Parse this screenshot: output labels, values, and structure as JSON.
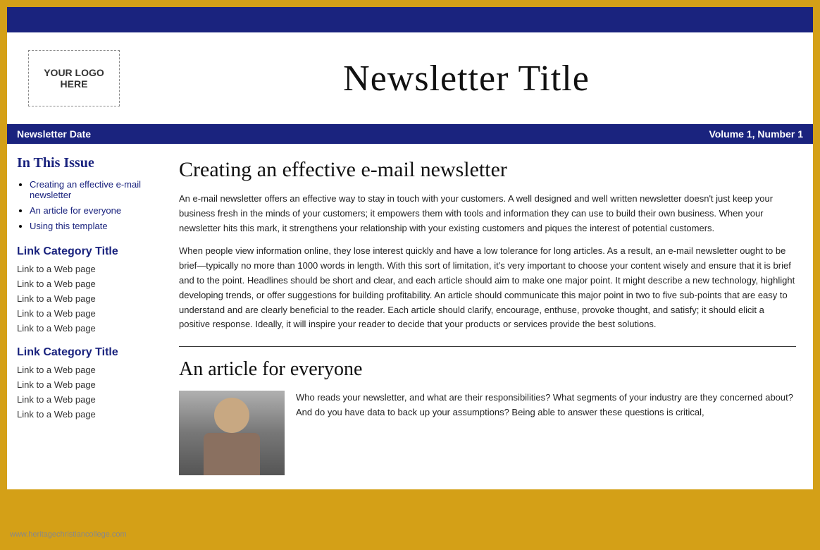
{
  "header": {
    "logo_line1": "YOUR LOGO",
    "logo_line2": "HERE",
    "newsletter_title": "Newsletter Title"
  },
  "date_bar": {
    "newsletter_date": "Newsletter Date",
    "volume": "Volume 1, Number 1"
  },
  "sidebar": {
    "in_this_issue_title": "In This Issue",
    "toc_items": [
      "Creating an effective e-mail newsletter",
      "An article for everyone",
      "Using this template"
    ],
    "link_category_1": {
      "title": "Link Category Title",
      "links": [
        "Link to a Web page",
        "Link to a Web page",
        "Link to a Web page",
        "Link to a Web page",
        "Link to a Web page"
      ]
    },
    "link_category_2": {
      "title": "Link Category Title",
      "links": [
        "Link to a Web page",
        "Link to a Web page",
        "Link to a Web page",
        "Link to a Web page"
      ]
    }
  },
  "main": {
    "article1": {
      "title": "Creating an effective e-mail newsletter",
      "paragraphs": [
        "An e-mail newsletter offers an effective way to stay in touch with your customers. A well designed and well written newsletter doesn't just keep your business fresh in the minds of your customers; it empowers them with tools and information they can use to build their own business. When your newsletter hits this mark, it strengthens your relationship with your existing customers and piques the interest of potential customers.",
        "When people view information online, they lose interest quickly and have a low tolerance for long articles. As a result, an e-mail newsletter ought to be brief—typically no more than 1000 words in length. With this sort of limitation, it's very important to choose your content wisely and ensure that it is brief and to the point. Headlines should be short and clear, and each article should aim to make one major point. It might describe a new technology, highlight developing trends, or offer suggestions for building profitability. An article should communicate this major point in two to five sub-points that are easy to understand and are clearly beneficial to the reader. Each article should clarify, encourage, enthuse, provoke thought, and satisfy; it should elicit a positive response. Ideally, it will inspire your reader to decide that your products or services provide the best solutions."
      ]
    },
    "article2": {
      "title": "An article for everyone",
      "body": "Who reads your newsletter, and what are their responsibilities? What segments of your industry are they concerned about? And do you have data to back up your assumptions? Being able to answer these questions is critical,"
    }
  },
  "watermark": "www.heritagechristiancollege.com"
}
